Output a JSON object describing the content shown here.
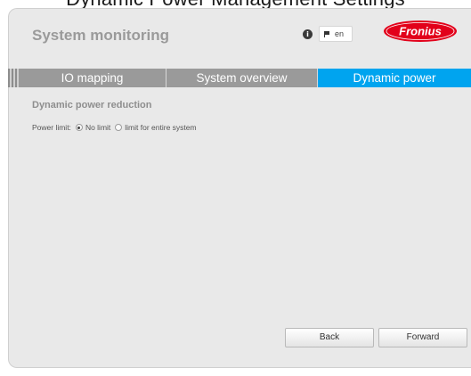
{
  "top_banner": "Dynamic Power Management Settings",
  "header": {
    "title": "System monitoring",
    "info_icon_glyph": "i",
    "language": "en",
    "logo_text": "Fronius",
    "logo_color": "#e2001a"
  },
  "tabs": [
    {
      "label": "IO mapping",
      "active": false
    },
    {
      "label": "System overview",
      "active": false
    },
    {
      "label": "Dynamic power",
      "active": true
    }
  ],
  "accent_color": "#00a4ef",
  "section": {
    "title": "Dynamic power reduction",
    "power_limit_label": "Power limit:",
    "options": [
      {
        "label": "No limit",
        "selected": true
      },
      {
        "label": "limit for entire system",
        "selected": false
      }
    ]
  },
  "buttons": {
    "back": "Back",
    "forward": "Forward"
  }
}
